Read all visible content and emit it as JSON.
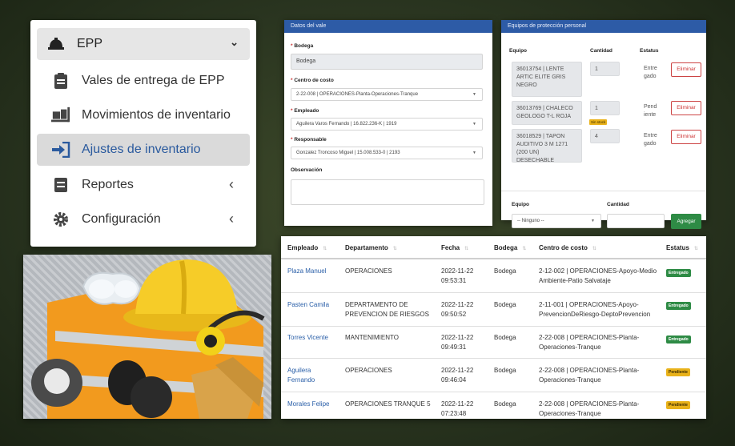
{
  "menu": {
    "header": "EPP",
    "items": [
      {
        "label": "Vales de entrega de EPP",
        "icon": "clipboard-icon"
      },
      {
        "label": "Movimientos de inventario",
        "icon": "dolly-icon"
      },
      {
        "label": "Ajustes de inventario",
        "icon": "sign-in-arrow-icon"
      },
      {
        "label": "Reportes",
        "icon": "report-icon"
      },
      {
        "label": "Configuración",
        "icon": "gear-icon"
      }
    ]
  },
  "voucher": {
    "title": "Datos del vale",
    "bodega_label": "Bodega",
    "bodega_value": "Bodega",
    "centro_label": "Centro de costo",
    "centro_value": "2-22-008 | OPERACIONES-Planta-Operaciones-Tranque",
    "empleado_label": "Empleado",
    "empleado_value": "Aguilera Varos Fernando | 16.822.236-K | 1919",
    "responsable_label": "Responsable",
    "responsable_value": "Gonzalez Troncoso Miguel | 15.008.533-0 | 2193",
    "observacion_label": "Observación"
  },
  "equipment": {
    "title": "Equipos de protección personal",
    "headers": {
      "equipo": "Equipo",
      "cantidad": "Cantidad",
      "estatus": "Estatus"
    },
    "rows": [
      {
        "equipo": [
          "36013754 | LENTE",
          "ARTIC ELITE GRIS",
          "NEGRO"
        ],
        "cantidad": "1",
        "estatus": [
          "Entre",
          "gado"
        ]
      },
      {
        "equipo": [
          "36013769 | CHALECO",
          "GEOLOGO T-L ROJA"
        ],
        "cantidad": "1",
        "estatus": [
          "Pend",
          "iente"
        ],
        "badge": "Sin stock"
      },
      {
        "equipo": [
          "36018529 | TAPON",
          "AUDITIVO 3 M 1271",
          "(200 UN) DESECHABLE"
        ],
        "cantidad": "4",
        "estatus": [
          "Entre",
          "gado"
        ]
      }
    ],
    "delete_label": "Eliminar",
    "add_form": {
      "equipo_label": "Equipo",
      "cantidad_label": "Cantidad",
      "select_value": "-- Ninguno --",
      "add_label": "Agregar"
    }
  },
  "table": {
    "headers": [
      "Empleado",
      "Departamento",
      "Fecha",
      "Bodega",
      "Centro de costo",
      "Estatus"
    ],
    "rows": [
      {
        "empleado": [
          "Plaza Manuel"
        ],
        "departamento": [
          "OPERACIONES"
        ],
        "fecha": [
          "2022-11-22",
          "09:53:31"
        ],
        "bodega": "Bodega",
        "centro": [
          "2-12-002 | OPERACIONES-Apoyo-Medio",
          "Ambiente-Patio Salvataje"
        ],
        "estatus": "Entregado"
      },
      {
        "empleado": [
          "Pasten Camila"
        ],
        "departamento": [
          "DEPARTAMENTO DE",
          "PREVENCION DE RIESGOS"
        ],
        "fecha": [
          "2022-11-22",
          "09:50:52"
        ],
        "bodega": "Bodega",
        "centro": [
          "2-11-001 | OPERACIONES-Apoyo-",
          "PrevencionDeRiesgo-DeptoPrevencion"
        ],
        "estatus": "Entregado"
      },
      {
        "empleado": [
          "Torres Vicente"
        ],
        "departamento": [
          "MANTENIMIENTO"
        ],
        "fecha": [
          "2022-11-22",
          "09:49:31"
        ],
        "bodega": "Bodega",
        "centro": [
          "2-22-008 | OPERACIONES-Planta-",
          "Operaciones-Tranque"
        ],
        "estatus": "Entregado"
      },
      {
        "empleado": [
          "Aguilera",
          "Fernando"
        ],
        "departamento": [
          "OPERACIONES"
        ],
        "fecha": [
          "2022-11-22",
          "09:46:04"
        ],
        "bodega": "Bodega",
        "centro": [
          "2-22-008 | OPERACIONES-Planta-",
          "Operaciones-Tranque"
        ],
        "estatus": "Pendiente"
      },
      {
        "empleado": [
          "Morales Felipe"
        ],
        "departamento": [
          "OPERACIONES TRANQUE 5"
        ],
        "fecha": [
          "2022-11-22",
          "07:23:48"
        ],
        "bodega": "Bodega",
        "centro": [
          "2-22-008 | OPERACIONES-Planta-",
          "Operaciones-Tranque"
        ],
        "estatus": "Pendiente"
      }
    ]
  },
  "colors": {
    "accent": "#2d5ba6",
    "active_link": "#2a5a9e",
    "success": "#2e8b45",
    "warning": "#e9b21a",
    "danger": "#cc3333"
  }
}
